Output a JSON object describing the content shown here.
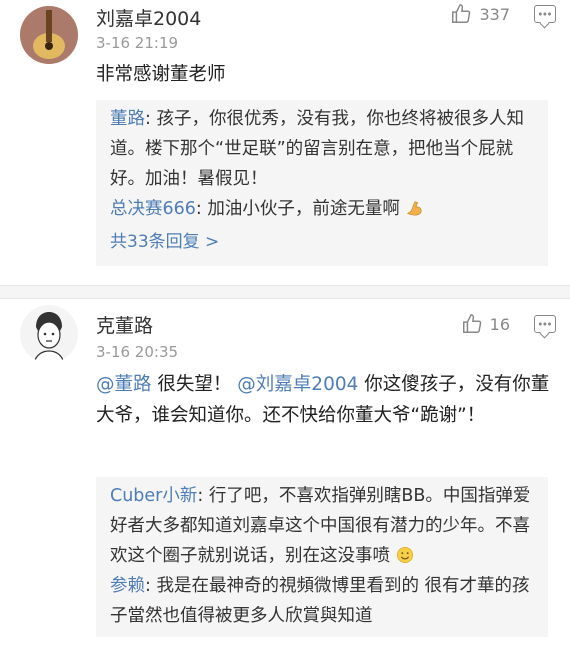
{
  "comments": [
    {
      "username": "刘嘉卓2004",
      "time": "3-16 21:19",
      "likes": "337",
      "text": "非常感谢董老师",
      "replies": [
        {
          "name": "董路",
          "text": ": 孩子，你很优秀，没有我，你也终将被很多人知道。楼下那个“世足联”的留言别在意，把他当个屁就好。加油！暑假见！"
        },
        {
          "name": "总决赛666",
          "text": ": 加油小伙子，前途无量啊",
          "emoji": "flexed-biceps"
        }
      ],
      "more_replies": "共33条回复 >"
    },
    {
      "username": "克董路",
      "time": "3-16 20:35",
      "likes": "16",
      "mention1": "@董路",
      "text_a": " 很失望！",
      "mention2": "@刘嘉卓2004",
      "text_b": " 你这傻孩子，没有你董大爷，谁会知道你。还不快给你董大爷“跪谢”！",
      "replies": [
        {
          "name": "Cuber小新",
          "text": ": 行了吧，不喜欢指弹别瞎BB。中国指弹爱好者大多都知道刘嘉卓这个中国很有潜力的少年。不喜欢这个圈子就别说话，别在这没事喷",
          "emoji": "grinning-face"
        },
        {
          "name": "参赖",
          "text": ": 我是在最神奇的視頻微博里看到的  很有才華的孩子當然也值得被更多人欣賞與知道"
        }
      ]
    }
  ]
}
